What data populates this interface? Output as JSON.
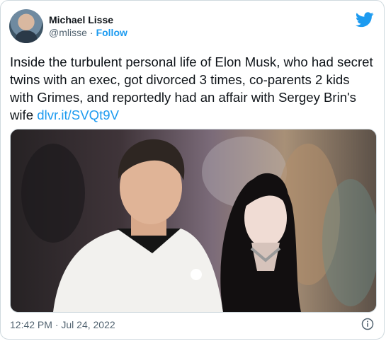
{
  "author": {
    "name": "Michael Lisse",
    "handle": "@mlisse",
    "separator": "·",
    "follow_label": "Follow"
  },
  "tweet": {
    "text": "Inside the turbulent personal life of Elon Musk, who had secret twins with an exec, got divorced 3 times, co-parents 2 kids with Grimes, and reportedly had an affair with Sergey Brin's wife ",
    "link": "dlvr.it/SVQt9V",
    "timestamp": "12:42 PM · Jul 24, 2022"
  },
  "icons": {
    "brand": "twitter-bird-icon",
    "info": "info-icon"
  },
  "colors": {
    "accent": "#1d9bf0",
    "text": "#0f1419",
    "secondary": "#536471",
    "border": "#cfd9de"
  }
}
